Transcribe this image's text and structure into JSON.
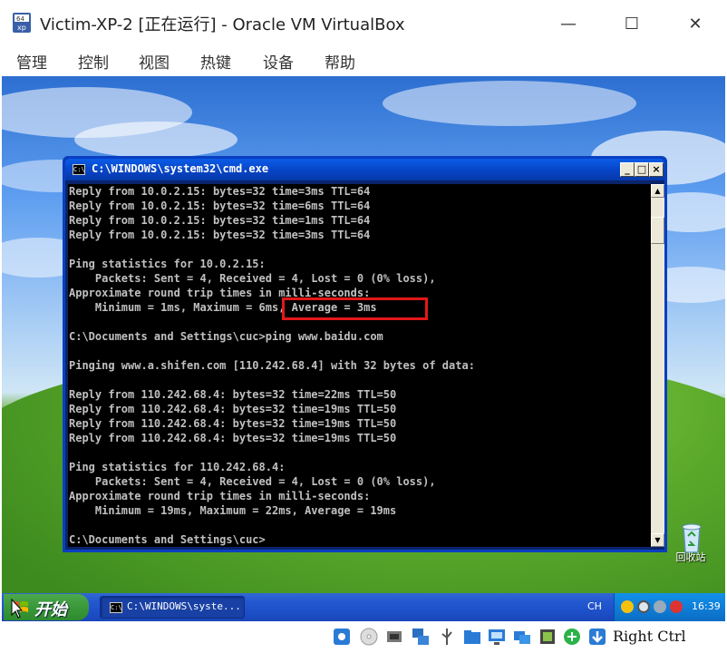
{
  "window": {
    "title": "Victim-XP-2 [正在运行] - Oracle VM VirtualBox",
    "controls": {
      "minimize": "—",
      "maximize": "☐",
      "close": "✕"
    }
  },
  "menubar": {
    "items": [
      "管理",
      "控制",
      "视图",
      "热键",
      "设备",
      "帮助"
    ]
  },
  "desktop": {
    "recycle_bin_label": "回收站"
  },
  "cmd_window": {
    "title": "C:\\WINDOWS\\system32\\cmd.exe",
    "icon_text": "C:\\",
    "lines": [
      "Reply from 10.0.2.15: bytes=32 time=3ms TTL=64",
      "Reply from 10.0.2.15: bytes=32 time=6ms TTL=64",
      "Reply from 10.0.2.15: bytes=32 time=1ms TTL=64",
      "Reply from 10.0.2.15: bytes=32 time=3ms TTL=64",
      "",
      "Ping statistics for 10.0.2.15:",
      "    Packets: Sent = 4, Received = 4, Lost = 0 (0% loss),",
      "Approximate round trip times in milli-seconds:",
      "    Minimum = 1ms, Maximum = 6ms, Average = 3ms",
      "",
      "C:\\Documents and Settings\\cuc>ping www.baidu.com",
      "",
      "Pinging www.a.shifen.com [110.242.68.4] with 32 bytes of data:",
      "",
      "Reply from 110.242.68.4: bytes=32 time=22ms TTL=50",
      "Reply from 110.242.68.4: bytes=32 time=19ms TTL=50",
      "Reply from 110.242.68.4: bytes=32 time=19ms TTL=50",
      "Reply from 110.242.68.4: bytes=32 time=19ms TTL=50",
      "",
      "Ping statistics for 110.242.68.4:",
      "    Packets: Sent = 4, Received = 4, Lost = 0 (0% loss),",
      "Approximate round trip times in milli-seconds:",
      "    Minimum = 19ms, Maximum = 22ms, Average = 19ms",
      "",
      "C:\\Documents and Settings\\cuc>"
    ]
  },
  "taskbar": {
    "start_label": "开始",
    "task_cmd_label": "C:\\WINDOWS\\syste...",
    "language": "CH",
    "clock": "16:39"
  },
  "statusbar": {
    "host_key": "Right Ctrl"
  },
  "colors": {
    "console_text": "#c0c0c0",
    "highlight": "#e21818",
    "xp_blue": "#0846c8",
    "start_green": "#3b9a3b"
  }
}
